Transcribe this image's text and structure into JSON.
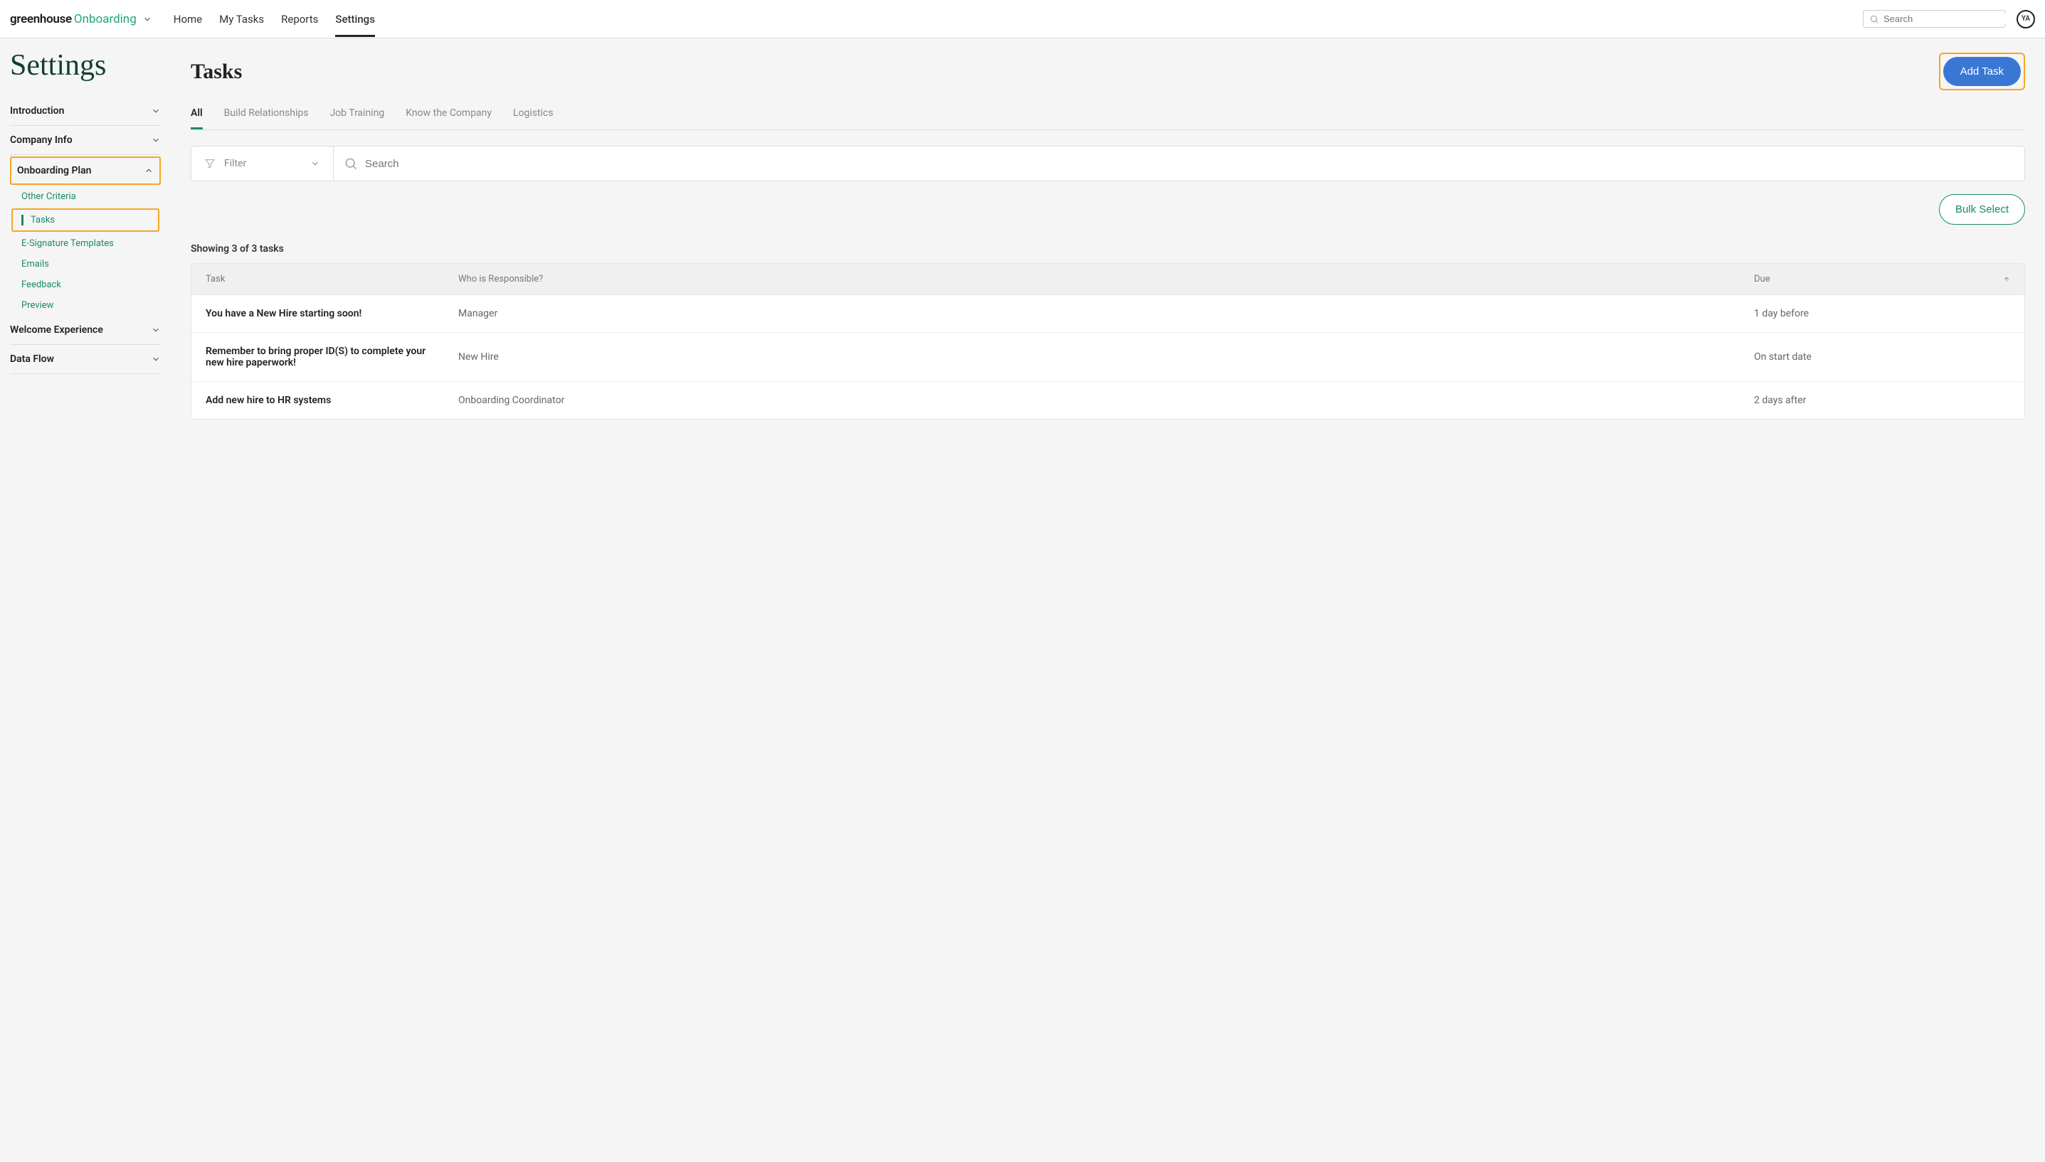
{
  "logo": {
    "main": "greenhouse",
    "sub": "Onboarding"
  },
  "nav": {
    "home": "Home",
    "my_tasks": "My Tasks",
    "reports": "Reports",
    "settings": "Settings"
  },
  "top_search_placeholder": "Search",
  "avatar_initials": "YA",
  "page_title": "Settings",
  "sidebar": {
    "introduction": "Introduction",
    "company_info": "Company Info",
    "onboarding_plan": "Onboarding Plan",
    "onboarding_sub": {
      "other_criteria": "Other Criteria",
      "tasks": "Tasks",
      "esig": "E-Signature Templates",
      "emails": "Emails",
      "feedback": "Feedback",
      "preview": "Preview"
    },
    "welcome_experience": "Welcome Experience",
    "data_flow": "Data Flow"
  },
  "main": {
    "title": "Tasks",
    "add_task": "Add Task",
    "tabs": {
      "all": "All",
      "build": "Build Relationships",
      "job": "Job Training",
      "know": "Know the Company",
      "logistics": "Logistics"
    },
    "filter_label": "Filter",
    "search_placeholder": "Search",
    "bulk_select": "Bulk Select",
    "count": "Showing 3 of 3 tasks",
    "columns": {
      "task": "Task",
      "responsible": "Who is Responsible?",
      "due": "Due"
    },
    "rows": [
      {
        "task": "You have a New Hire starting soon!",
        "responsible": "Manager",
        "due": "1 day before"
      },
      {
        "task": "Remember to bring proper ID(S) to complete your new hire paperwork!",
        "responsible": "New Hire",
        "due": "On start date"
      },
      {
        "task": "Add new hire to HR systems",
        "responsible": "Onboarding Coordinator",
        "due": "2 days after"
      }
    ]
  }
}
